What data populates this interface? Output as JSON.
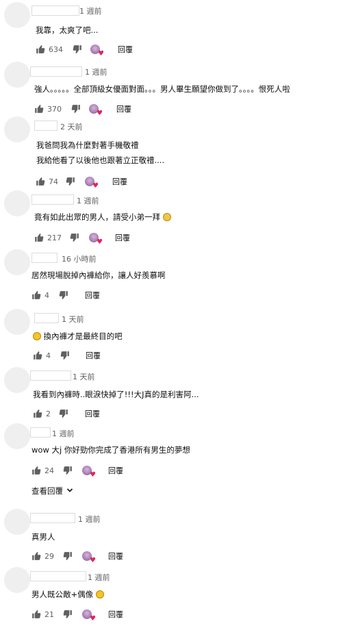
{
  "comments": [
    {
      "time": "1 週前",
      "lines": [
        "我靠，太爽了吧..."
      ],
      "likes": "634",
      "reply": "回覆",
      "hearted": true
    },
    {
      "time": "1 週前",
      "lines": [
        "強人。。。。。全部頂級女優面對面。。。男人畢生願望你做到了。。。。恨死人啦"
      ],
      "likes": "370",
      "reply": "回覆",
      "hearted": true
    },
    {
      "time": "2 天前",
      "lines": [
        "我爸問我為什麼對著手機敬禮",
        "我給他看了以後他也跟著立正敬禮...."
      ],
      "likes": "74",
      "reply": "回覆",
      "hearted": true
    },
    {
      "time": "1 週前",
      "lines": [
        "竟有如此出眾的男人，請受小弟一拜"
      ],
      "likes": "217",
      "reply": "回覆",
      "hearted": true,
      "emoji": "bowing-emoji"
    },
    {
      "time": "16 小時前",
      "lines": [
        "居然現場脫掉內褲給你，讓人好羨慕啊"
      ],
      "likes": "4",
      "reply": "回覆",
      "hearted": false
    },
    {
      "time": "1 天前",
      "lines": [
        "換內褲才是最終目的吧"
      ],
      "likes": "4",
      "reply": "回覆",
      "hearted": false,
      "emoji": "laughing-emoji"
    },
    {
      "time": "1 天前",
      "lines": [
        "我看到內褲時..眼淚快掉了!!!大J真的是利害阿..."
      ],
      "likes": "2",
      "reply": "回覆",
      "hearted": false
    },
    {
      "time": "1 週前",
      "lines": [
        "wow 大j 你好勁你完成了香港所有男生的夢想"
      ],
      "likes": "24",
      "reply": "回覆",
      "hearted": true
    },
    {
      "time": "1 週前",
      "lines": [
        "真男人"
      ],
      "likes": "29",
      "reply": "回覆",
      "hearted": true
    },
    {
      "time": "1 週前",
      "lines": [
        "男人既公敵+偶像"
      ],
      "likes": "21",
      "reply": "回覆",
      "hearted": true,
      "emoji": "grinning-emoji"
    }
  ],
  "view_replies": {
    "label": "查看回覆"
  },
  "colors": {
    "heart": "#e0245e",
    "secondary_text": "#606060",
    "avatar_placeholder": "#efefef"
  }
}
